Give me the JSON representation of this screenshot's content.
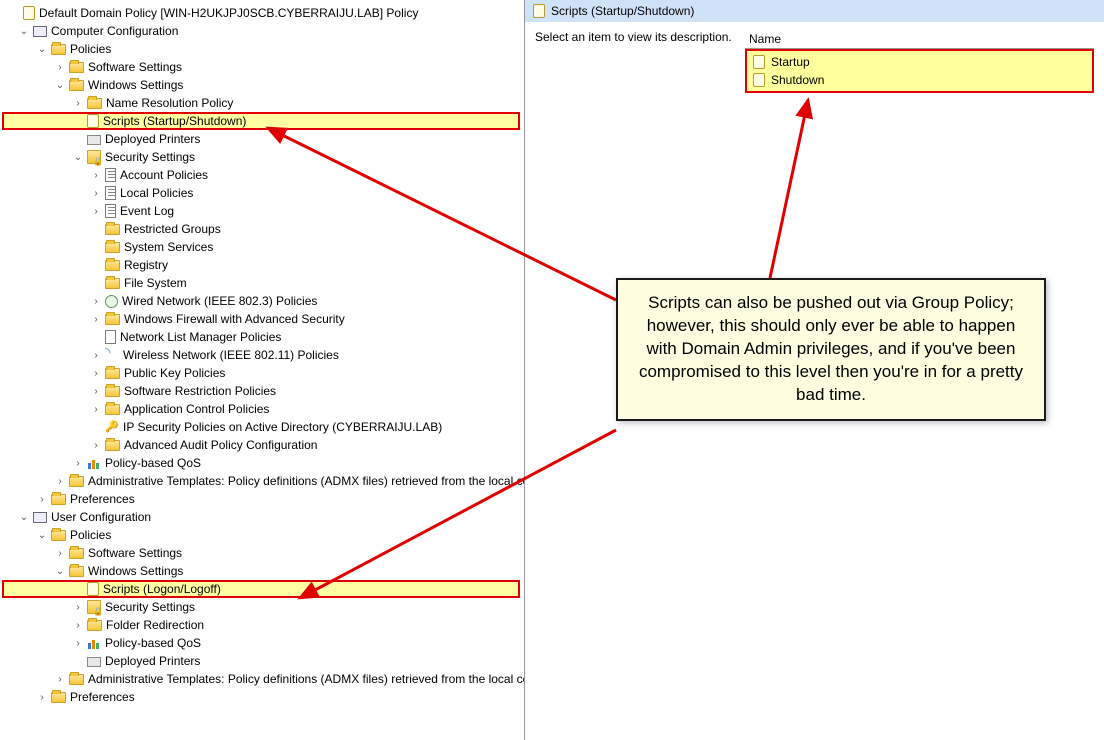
{
  "root_title": "Default Domain Policy [WIN-H2UKJPJ0SCB.CYBERRAIJU.LAB] Policy",
  "computer_config": {
    "label": "Computer Configuration",
    "policies": {
      "label": "Policies"
    },
    "software_settings": "Software Settings",
    "windows_settings": "Windows Settings",
    "name_resolution": "Name Resolution Policy",
    "scripts_startup": "Scripts (Startup/Shutdown)",
    "deployed_printers": "Deployed Printers",
    "security_settings": "Security Settings",
    "sec": {
      "account": "Account Policies",
      "local": "Local Policies",
      "eventlog": "Event Log",
      "restricted": "Restricted Groups",
      "system_services": "System Services",
      "registry": "Registry",
      "filesystem": "File System",
      "wired": "Wired Network (IEEE 802.3) Policies",
      "firewall": "Windows Firewall with Advanced Security",
      "network_list": "Network List Manager Policies",
      "wireless": "Wireless Network (IEEE 802.11) Policies",
      "pubkey": "Public Key Policies",
      "software_restriction": "Software Restriction Policies",
      "appcontrol": "Application Control Policies",
      "ipsec": "IP Security Policies on Active Directory (CYBERRAIJU.LAB)",
      "audit": "Advanced Audit Policy Configuration"
    },
    "qos": "Policy-based QoS",
    "admin_templates": "Administrative Templates: Policy definitions (ADMX files) retrieved from the local computer.",
    "preferences": "Preferences"
  },
  "user_config": {
    "label": "User Configuration",
    "policies": "Policies",
    "software_settings": "Software Settings",
    "windows_settings": "Windows Settings",
    "scripts_logon": "Scripts (Logon/Logoff)",
    "security_settings": "Security Settings",
    "folder_redirection": "Folder Redirection",
    "qos": "Policy-based QoS",
    "deployed_printers": "Deployed Printers",
    "admin_templates": "Administrative Templates: Policy definitions (ADMX files) retrieved from the local computer.",
    "preferences": "Preferences"
  },
  "right": {
    "title": "Scripts (Startup/Shutdown)",
    "description_label": "Select an item to view its description.",
    "name_header": "Name",
    "items": [
      "Startup",
      "Shutdown"
    ]
  },
  "callout_text": "Scripts can also be pushed out via Group Policy; however, this should only ever be able to happen with Domain Admin privileges, and if you've been compromised to this level then you're in for a pretty bad time."
}
